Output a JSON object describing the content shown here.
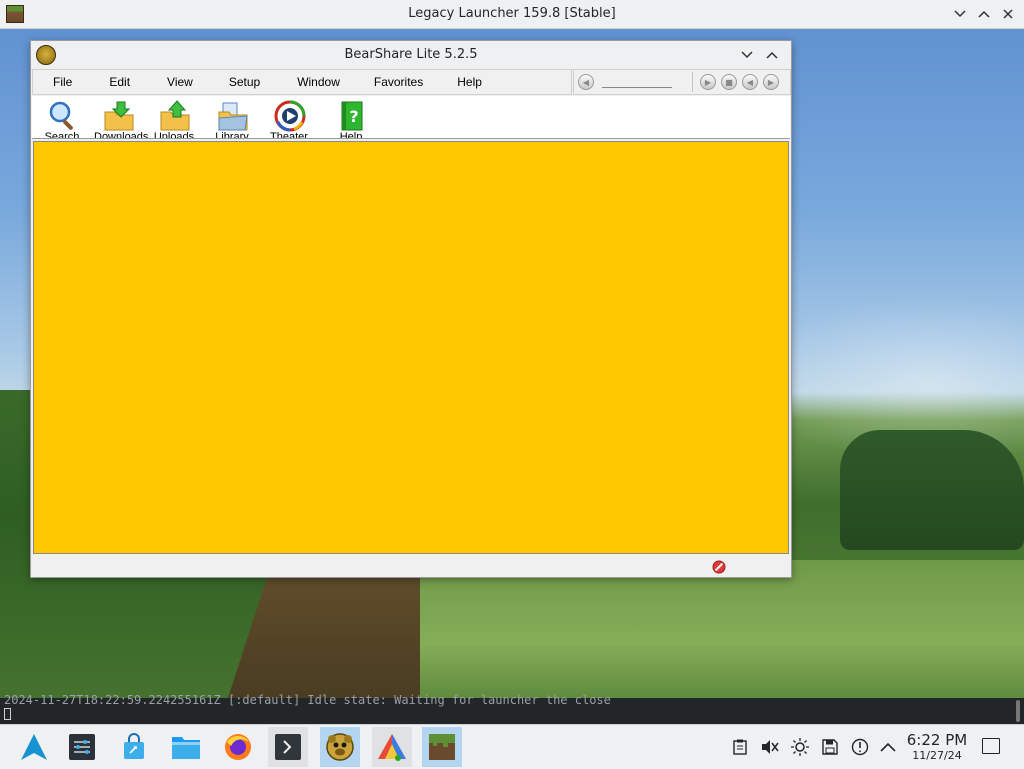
{
  "outer_window": {
    "title": "Legacy Launcher 159.8 [Stable]",
    "controls": [
      "minimize",
      "maximize",
      "close"
    ]
  },
  "bearshare": {
    "title": "BearShare Lite 5.2.5",
    "menu": {
      "file": "File",
      "edit": "Edit",
      "view": "View",
      "setup": "Setup",
      "window": "Window",
      "favorites": "Favorites",
      "help": "Help"
    },
    "toolbar": [
      {
        "label": "Search",
        "icon": "magnifier-icon"
      },
      {
        "label": "Downloads",
        "icon": "download-folder-icon"
      },
      {
        "label": "Uploads",
        "icon": "upload-folder-icon"
      },
      {
        "label": "Library",
        "icon": "library-folder-icon"
      },
      {
        "label": "Theater",
        "icon": "media-player-icon"
      },
      {
        "label": "Help",
        "icon": "help-book-icon"
      }
    ],
    "content_color": "#ffc800"
  },
  "terminal": {
    "line": "2024-11-27T18:22:59.224255161Z [:default] Idle state: Waiting for launcher the close"
  },
  "taskbar": {
    "apps": [
      {
        "name": "application-launcher",
        "icon": "arch-logo-icon"
      },
      {
        "name": "system-settings",
        "icon": "settings-sliders-icon"
      },
      {
        "name": "discover",
        "icon": "store-bag-icon"
      },
      {
        "name": "file-manager",
        "icon": "folder-icon"
      },
      {
        "name": "firefox",
        "icon": "firefox-icon"
      },
      {
        "name": "terminal",
        "icon": "terminal-icon"
      },
      {
        "name": "bearshare",
        "icon": "bearshare-icon"
      },
      {
        "name": "wine-installer",
        "icon": "triangle-app-icon"
      },
      {
        "name": "legacy-launcher",
        "icon": "grass-block-icon"
      }
    ],
    "tray": [
      "clipboard-icon",
      "volume-muted-icon",
      "brightness-icon",
      "save-icon",
      "updates-icon",
      "expand-tray-icon"
    ],
    "clock": {
      "time": "6:22 PM",
      "date": "11/27/24"
    }
  }
}
